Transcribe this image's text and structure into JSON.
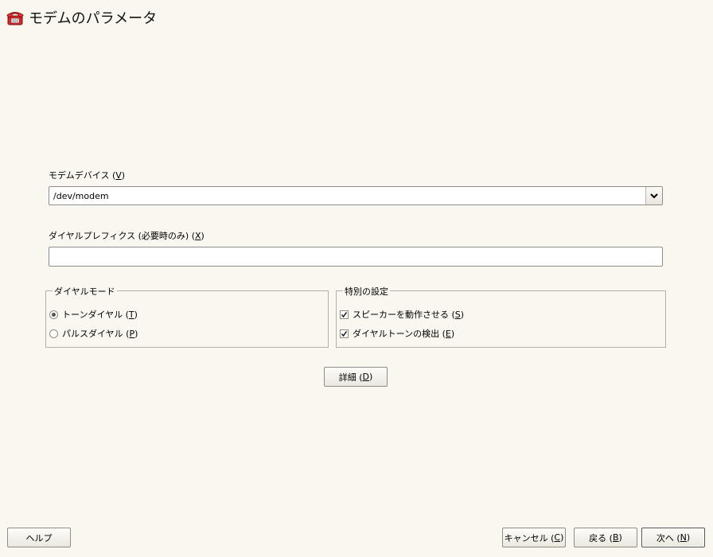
{
  "window": {
    "title": "モデムのパラメータ",
    "icon": "telephone-icon",
    "accent": "#cc2222"
  },
  "modem_device": {
    "label_text": "モデムデバイス (",
    "label_key": "V",
    "label_end": ")",
    "value": "/dev/modem"
  },
  "dial_prefix": {
    "label_text": "ダイヤルプレフィクス (必要時のみ) (",
    "label_key": "X",
    "label_end": ")",
    "value": ""
  },
  "dial_mode": {
    "title": "ダイヤルモード",
    "options": [
      {
        "text": "トーンダイヤル (",
        "key": "T",
        "end": ")",
        "selected": true
      },
      {
        "text": "パルスダイヤル (",
        "key": "P",
        "end": ")",
        "selected": false
      }
    ]
  },
  "special": {
    "title": "特別の設定",
    "options": [
      {
        "text": "スピーカーを動作させる (",
        "key": "S",
        "end": ")",
        "checked": true
      },
      {
        "text": "ダイヤルトーンの検出 (",
        "key": "E",
        "end": ")",
        "checked": true
      }
    ]
  },
  "details_button": {
    "text": "詳細 (",
    "key": "D",
    "end": ")"
  },
  "footer": {
    "help": "ヘルプ",
    "cancel": {
      "text": "キャンセル (",
      "key": "C",
      "end": ")"
    },
    "back": {
      "text": "戻る (",
      "key": "B",
      "end": ")"
    },
    "next": {
      "text": "次へ (",
      "key": "N",
      "end": ")"
    }
  }
}
